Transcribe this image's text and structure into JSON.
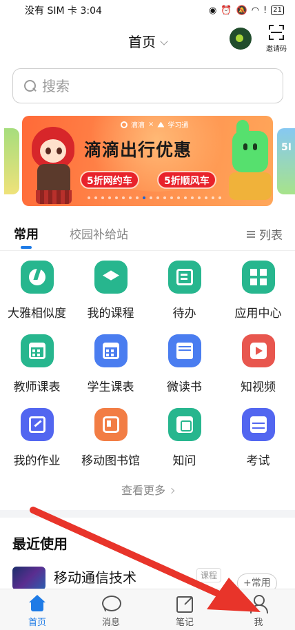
{
  "status_bar": {
    "carrier": "没有 SIM 卡",
    "time": "3:04",
    "battery": "21"
  },
  "header": {
    "title": "首页",
    "scan_label": "邀请码"
  },
  "search": {
    "placeholder": "搜索"
  },
  "banner": {
    "brand_1": "滴滴",
    "brand_sep": "×",
    "brand_2": "学习通",
    "title": "滴滴出行优惠",
    "pill_1": "5折网约车",
    "pill_2": "5折顺风车",
    "side_text": "5I"
  },
  "tabs": {
    "common": "常用",
    "campus": "校园补给站",
    "list_toggle": "列表"
  },
  "apps": [
    {
      "label": "大雅相似度",
      "icon": "pie-chart-icon"
    },
    {
      "label": "我的课程",
      "icon": "graduation-cap-icon"
    },
    {
      "label": "待办",
      "icon": "todo-icon"
    },
    {
      "label": "应用中心",
      "icon": "app-grid-icon"
    },
    {
      "label": "教师课表",
      "icon": "calendar-icon"
    },
    {
      "label": "学生课表",
      "icon": "calendar-icon"
    },
    {
      "label": "微读书",
      "icon": "book-icon",
      "icon_text": "微读书"
    },
    {
      "label": "知视频",
      "icon": "video-icon",
      "icon_text": "知视频"
    },
    {
      "label": "我的作业",
      "icon": "homework-icon"
    },
    {
      "label": "移动图书馆",
      "icon": "phone-library-icon"
    },
    {
      "label": "知问",
      "icon": "qa-icon"
    },
    {
      "label": "考试",
      "icon": "exam-icon"
    }
  ],
  "more_label": "查看更多",
  "recent": {
    "title": "最近使用",
    "item_name": "移动通信技术",
    "item_tag": "课程",
    "add_label": "+常用"
  },
  "bottom_nav": [
    {
      "label": "首页",
      "active": true
    },
    {
      "label": "消息",
      "active": false
    },
    {
      "label": "笔记",
      "active": false
    },
    {
      "label": "我",
      "active": false
    }
  ],
  "colors": {
    "accent": "#1e7be6",
    "annotation_arrow": "#e8342a"
  }
}
